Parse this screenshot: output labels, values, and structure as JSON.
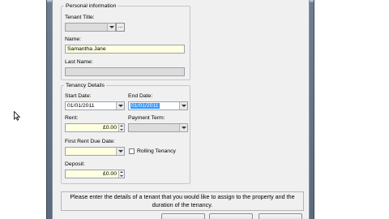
{
  "personal": {
    "legend": "Personal information",
    "title_label": "Tenant Title:",
    "title_value": "",
    "ellipsis": "...",
    "name_label": "Name:",
    "name_value": "Samantha Jane",
    "lastname_label": "Last Name:",
    "lastname_value": ""
  },
  "tenancy": {
    "legend": "Tenancy Details",
    "start_label": "Start Date:",
    "start_value": "01/01/2011",
    "end_label": "End Date:",
    "end_value": "01/01/2011",
    "rent_label": "Rent:",
    "rent_value": "£0.00",
    "payment_label": "Payment Term:",
    "payment_value": "",
    "first_due_label": "First Rent Due Date:",
    "first_due_value": "",
    "rolling_label": "Rolling Tenancy",
    "rolling_checked": false,
    "deposit_label": "Deposit:",
    "deposit_value": "£0.00"
  },
  "hint": {
    "line1": "Please enter the details of a tenant that you would like to assign to the property and the",
    "line2": "duration of the tenancy."
  }
}
